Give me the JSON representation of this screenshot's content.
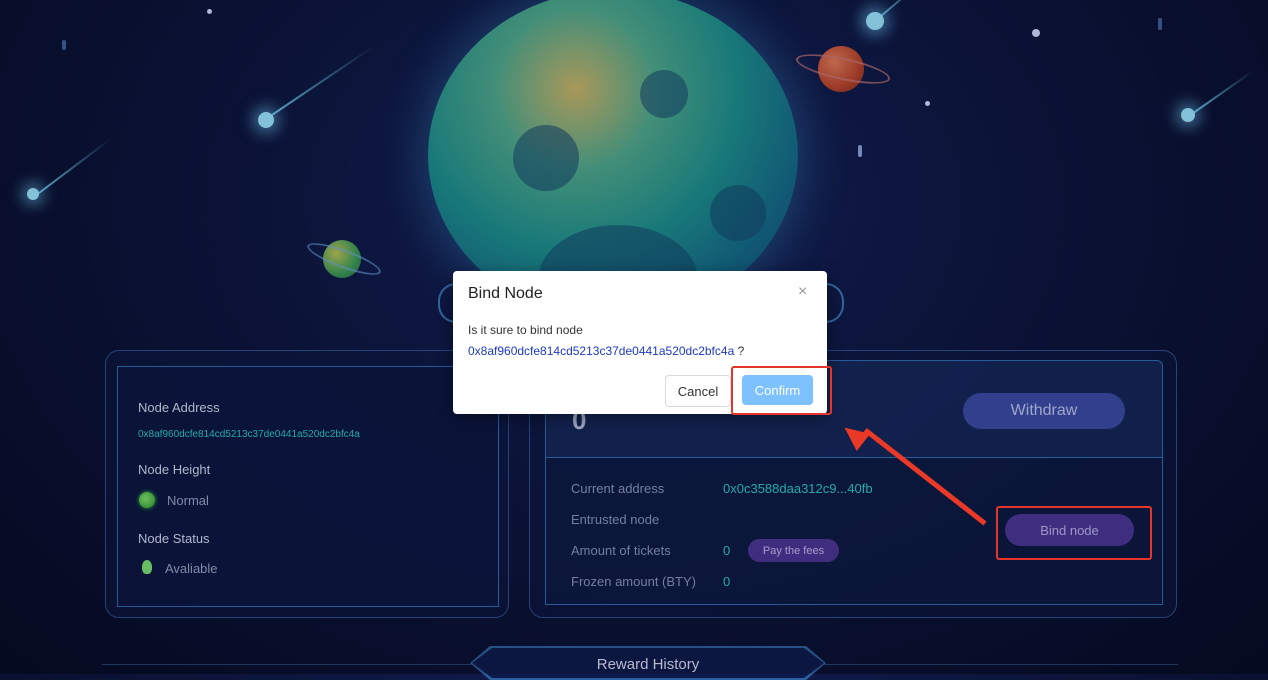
{
  "colors": {
    "accent_cyan": "#28c8c8",
    "confirm_blue": "#7ec1ff",
    "annotation_red": "#e4352a",
    "withdraw_bg": "#3a4aa6",
    "bind_node_bg": "#4a3696"
  },
  "icons": {
    "modal_close": "close-icon",
    "node_height_status": "green-dot-icon",
    "node_status": "lightbulb-icon"
  },
  "node_info": {
    "address_label": "Node Address",
    "address_value": "0x8af960dcfe814cd5213c37de0441a520dc2bfc4a",
    "height_label": "Node Height",
    "height_value": "Normal",
    "status_label": "Node Status",
    "status_value": "Avaliable"
  },
  "account": {
    "big_value": "0",
    "withdraw_label": "Withdraw",
    "current_address_label": "Current address",
    "current_address_value": "0x0c3588daa312c9...40fb",
    "entrusted_node_label": "Entrusted node",
    "tickets_label": "Amount of tickets",
    "tickets_value": "0",
    "pay_fees_label": "Pay the fees",
    "frozen_label": "Frozen amount (BTY)",
    "frozen_value": "0",
    "bind_node_label": "Bind node"
  },
  "reward_history": {
    "title": "Reward History"
  },
  "modal": {
    "title": "Bind Node",
    "message": "Is it sure to bind node",
    "address": "0x8af960dcfe814cd5213c37de0441a520dc2bfc4a",
    "suffix": " ?",
    "close_glyph": "×",
    "cancel_label": "Cancel",
    "confirm_label": "Confirm"
  }
}
